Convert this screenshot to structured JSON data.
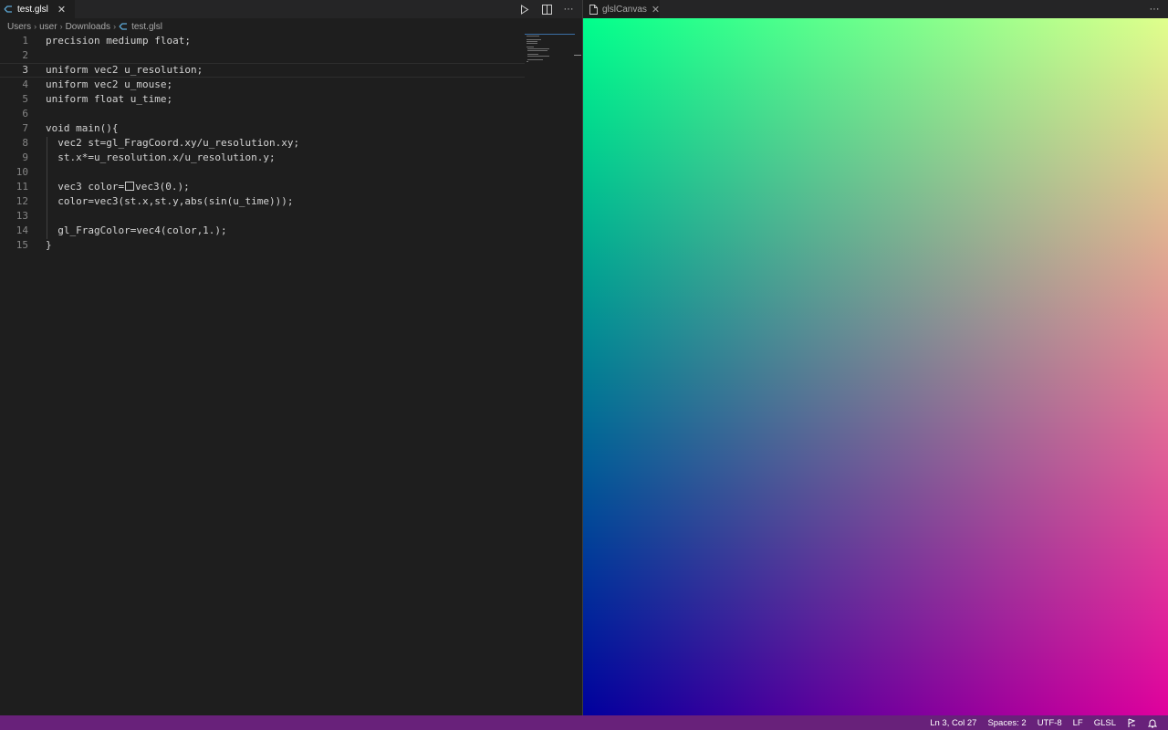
{
  "left_tab": {
    "label": "test.glsl",
    "close": "✕"
  },
  "left_actions": {
    "run_icon": "play-icon",
    "split_icon": "split-editor-icon",
    "more": "···"
  },
  "breadcrumb": [
    "Users",
    "user",
    "Downloads",
    "test.glsl"
  ],
  "code_lines": [
    {
      "n": "1",
      "t": "precision mediump float;"
    },
    {
      "n": "2",
      "t": ""
    },
    {
      "n": "3",
      "t": "uniform vec2 u_resolution;"
    },
    {
      "n": "4",
      "t": "uniform vec2 u_mouse;"
    },
    {
      "n": "5",
      "t": "uniform float u_time;"
    },
    {
      "n": "6",
      "t": ""
    },
    {
      "n": "7",
      "t": "void main(){"
    },
    {
      "n": "8",
      "t": "  vec2 st=gl_FragCoord.xy/u_resolution.xy;"
    },
    {
      "n": "9",
      "t": "  st.x*=u_resolution.x/u_resolution.y;"
    },
    {
      "n": "10",
      "t": ""
    },
    {
      "n": "11",
      "pre": "  vec3 color=",
      "post": "vec3(0.);"
    },
    {
      "n": "12",
      "t": "  color=vec3(st.x,st.y,abs(sin(u_time)));"
    },
    {
      "n": "13",
      "t": ""
    },
    {
      "n": "14",
      "t": "  gl_FragColor=vec4(color,1.);"
    },
    {
      "n": "15",
      "t": "}"
    }
  ],
  "right_tab": {
    "label": "glslCanvas",
    "close": "✕"
  },
  "right_actions": {
    "more": "···"
  },
  "status": {
    "position": "Ln 3, Col 27",
    "spaces": "Spaces: 2",
    "encoding": "UTF-8",
    "eol": "LF",
    "language": "GLSL"
  },
  "colors": {
    "status_bar": "#68217a",
    "canvas_top_left": "#00ff6a",
    "canvas_top_right": "#d4ff6a",
    "canvas_bottom_left": "#000080",
    "canvas_bottom_right": "#e0007a"
  }
}
